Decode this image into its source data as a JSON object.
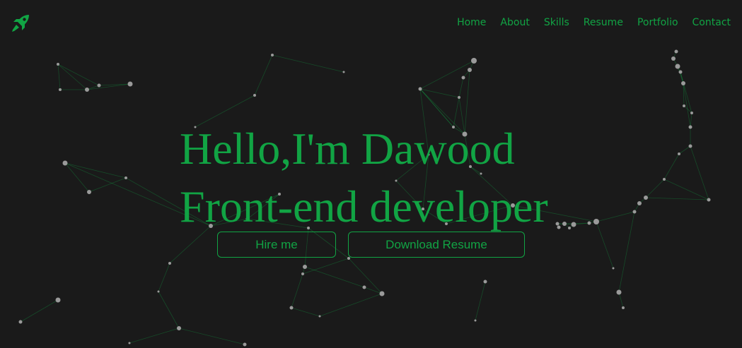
{
  "theme": {
    "accent": "#11a444",
    "background": "#1a1a1a",
    "node_color": "#9a9a9a",
    "line_color": "#11a444"
  },
  "header": {
    "logo_icon": "rocket-icon",
    "nav": [
      {
        "label": "Home"
      },
      {
        "label": "About"
      },
      {
        "label": "Skills"
      },
      {
        "label": "Resume"
      },
      {
        "label": "Portfolio"
      },
      {
        "label": "Contact"
      }
    ]
  },
  "hero": {
    "line1": "Hello,I'm Dawood",
    "line2": "Front-end developer",
    "hire_label": "Hire me",
    "download_label": "Download Resume"
  }
}
